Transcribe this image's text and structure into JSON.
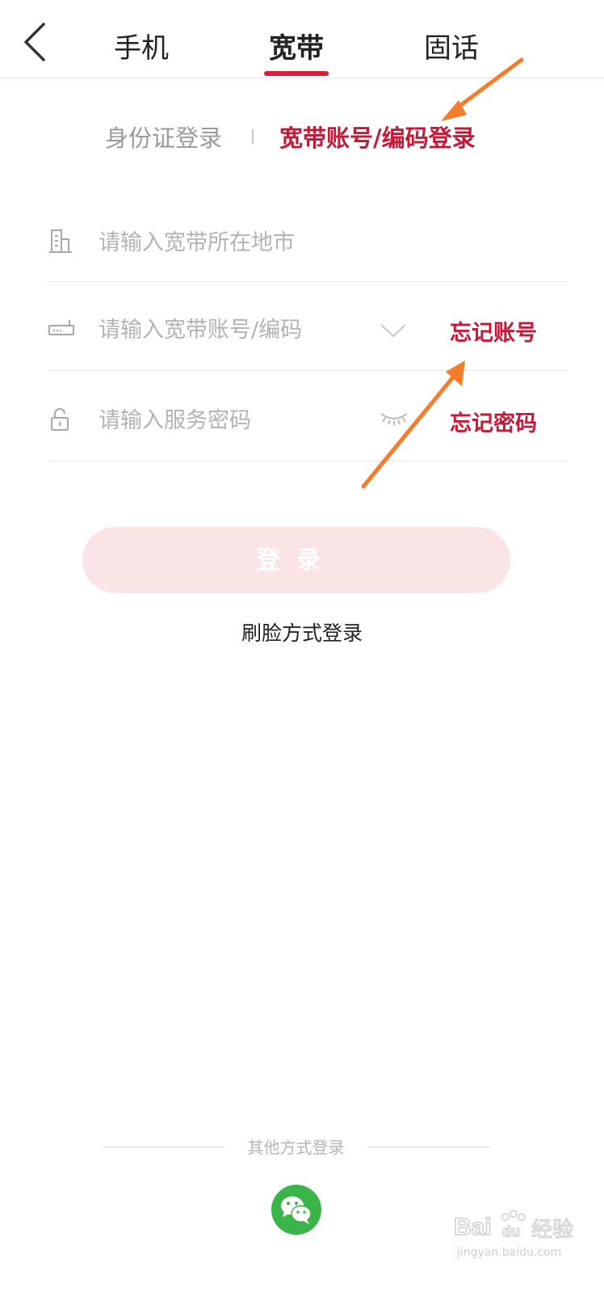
{
  "header": {
    "tabs": [
      {
        "label": "手机",
        "active": false
      },
      {
        "label": "宽带",
        "active": true
      },
      {
        "label": "固话",
        "active": false
      }
    ]
  },
  "login_type": {
    "id_card": "身份证登录",
    "account": "宽带账号/编码登录",
    "active": "account"
  },
  "form": {
    "city": {
      "placeholder": "请输入宽带所在地市",
      "value": ""
    },
    "account": {
      "placeholder": "请输入宽带账号/编码",
      "value": "",
      "forgot": "忘记账号"
    },
    "password": {
      "placeholder": "请输入服务密码",
      "value": "",
      "forgot": "忘记密码"
    }
  },
  "login_button": "登录",
  "face_login": "刷脸方式登录",
  "other_login": {
    "label": "其他方式登录",
    "methods": [
      "wechat"
    ]
  },
  "watermark": {
    "brand": "Bai",
    "brand_du": "du",
    "brand_cn": "经验",
    "url": "jingyan.baidu.com"
  },
  "icons": {
    "back": "chevron-left-icon",
    "city": "building-icon",
    "account": "router-icon",
    "password": "lock-icon",
    "dropdown": "chevron-down-icon",
    "visibility": "eye-closed-icon",
    "wechat": "wechat-icon"
  },
  "colors": {
    "accent": "#c41a38",
    "tab_underline": "#d71f3a",
    "login_button_bg": "#fbe4e6",
    "wechat": "#3bb54a",
    "annotation_arrow": "#f57c2a"
  }
}
